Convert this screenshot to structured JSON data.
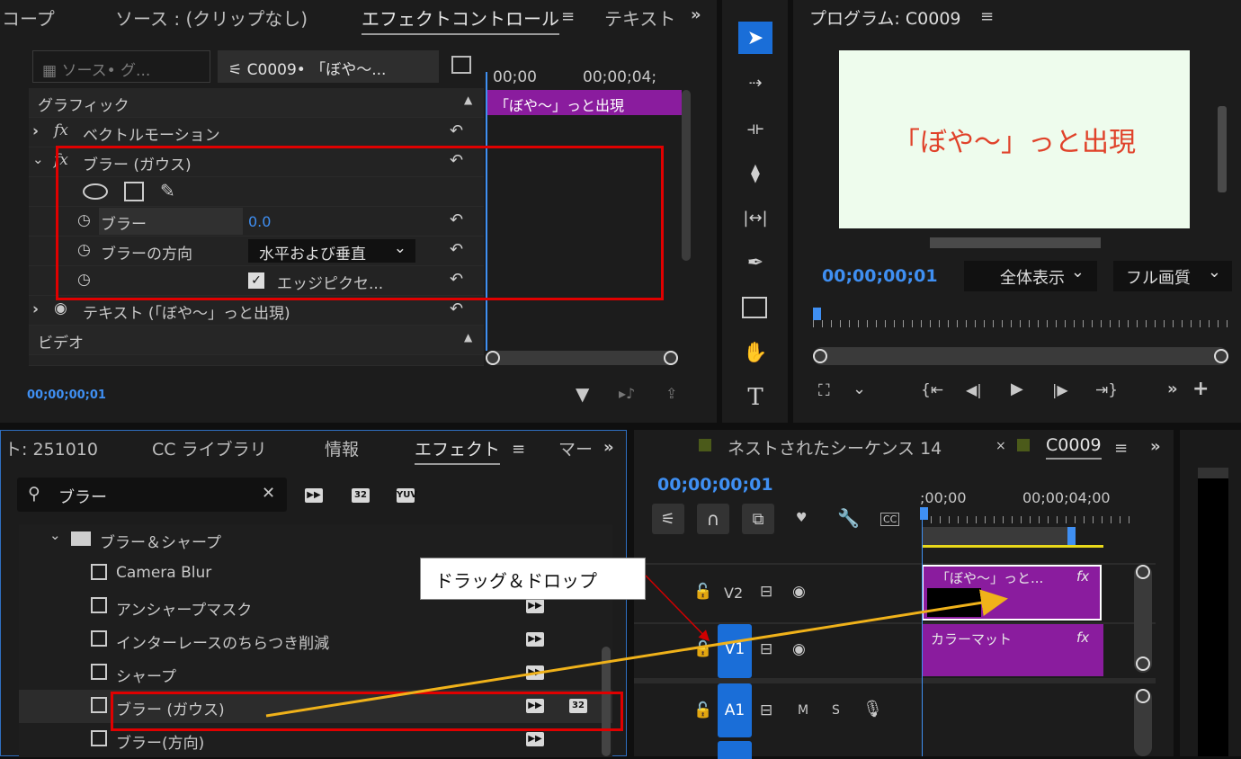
{
  "effect_controls": {
    "tabs": [
      "コープ",
      "ソース : (クリップなし)",
      "エフェクトコントロール",
      "テキスト"
    ],
    "source_label": "ソース• グ...",
    "clip_label": "C0009• 「ぼや～...",
    "time_start": "00;00",
    "time_end": "00;00;04;",
    "clip_bar": "「ぼや～」っと出現",
    "section_graphic": "グラフィック",
    "rows": {
      "vector_motion": "ベクトルモーション",
      "gaussian_blur": "ブラー (ガウス)",
      "blur": "ブラー",
      "blur_value": "0.0",
      "blur_direction": "ブラーの方向",
      "direction_value": "水平および垂直",
      "edge_pixels": "エッジピクセ...",
      "text_layer": "テキスト (「ぼや～」っと出現)"
    },
    "section_video": "ビデオ",
    "timecode": "00;00;00;01"
  },
  "program": {
    "title": "プログラム: C0009",
    "preview_text": "「ぼや～」っと出現",
    "timecode": "00;00;00;01",
    "zoom": "全体表示",
    "quality": "フル画質",
    "preview_bg": "#eefced",
    "preview_text_color": "#e0422a"
  },
  "effects_panel": {
    "tabs": [
      "ト: 251010",
      "CC ライブラリ",
      "情報",
      "エフェクト",
      "マー"
    ],
    "search_value": "ブラー",
    "folder": "ブラー＆シャープ",
    "items": [
      "Camera Blur",
      "アンシャープマスク",
      "インターレースのちらつき削減",
      "シャープ",
      "ブラー (ガウス)",
      "ブラー(方向)"
    ]
  },
  "timeline": {
    "tab_nested": "ネストされたシーケンス 14",
    "tab_active": "C0009",
    "timecode": "00;00;00;01",
    "ruler_start": ";00;00",
    "ruler_mid": "00;00;04;00",
    "tracks": [
      "V2",
      "V1",
      "A1"
    ],
    "audio_m": "M",
    "audio_s": "S",
    "clip_v2": "「ぼや～」っと...",
    "clip_v1": "カラーマット",
    "fx": "fx"
  },
  "annotation": {
    "callout": "ドラッグ＆ドロップ"
  },
  "tools": [
    "selection-tool",
    "track-select-tool",
    "ripple-edit-tool",
    "razor-tool",
    "slip-tool",
    "pen-tool",
    "rectangle-tool",
    "hand-tool",
    "type-tool"
  ]
}
